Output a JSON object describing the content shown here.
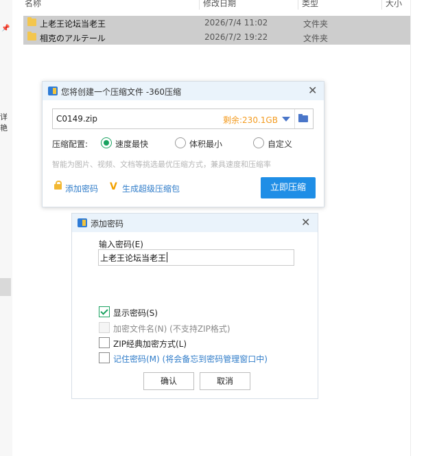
{
  "explorer": {
    "columns": {
      "name": "名称",
      "date": "修改日期",
      "type": "类型",
      "size": "大小"
    },
    "rows": [
      {
        "name": "上老王论坛当老王",
        "date": "2026/7/4 11:02",
        "type": "文件夹"
      },
      {
        "name": "相克のアルテール",
        "date": "2026/7/2 19:22",
        "type": "文件夹"
      }
    ],
    "left_fragment": "详艳",
    "pin_glyph": "📌"
  },
  "compress_dialog": {
    "title": "您将创建一个压缩文件 -360压缩",
    "filename": "C0149.zip",
    "free_space": "剩余:230.1GB",
    "config_label": "压缩配置:",
    "options": [
      "速度最快",
      "体积最小",
      "自定义"
    ],
    "selected_option": "速度最快",
    "hint": "智能为图片、视频、文档等挑选最优压缩方式，兼具速度和压缩率",
    "add_password": "添加密码",
    "super_compress": "生成超级压缩包",
    "compress_button": "立即压缩",
    "colors": {
      "accent": "#1f8ee6",
      "free_space": "#f39a1e",
      "radio": "#1aa260"
    }
  },
  "password_dialog": {
    "title": "添加密码",
    "input_label": "输入密码(E)",
    "password_value": "上老王论坛当老王",
    "checkboxes": [
      {
        "label": "显示密码(S)",
        "checked": true,
        "enabled": true
      },
      {
        "label": "加密文件名(N)  (不支持ZIP格式)",
        "checked": false,
        "enabled": false
      },
      {
        "label": "ZIP经典加密方式(L)",
        "checked": false,
        "enabled": true
      },
      {
        "label": "记住密码(M)  (将会备忘到密码管理窗口中)",
        "checked": false,
        "enabled": true
      }
    ],
    "ok_button": "确认",
    "cancel_button": "取消"
  },
  "icons": [
    "pin-icon",
    "folder-icon",
    "app-360-icon",
    "close-icon",
    "dropdown-arrow-icon",
    "browse-folder-icon",
    "lock-icon",
    "v-badge-icon",
    "checkmark-icon"
  ]
}
